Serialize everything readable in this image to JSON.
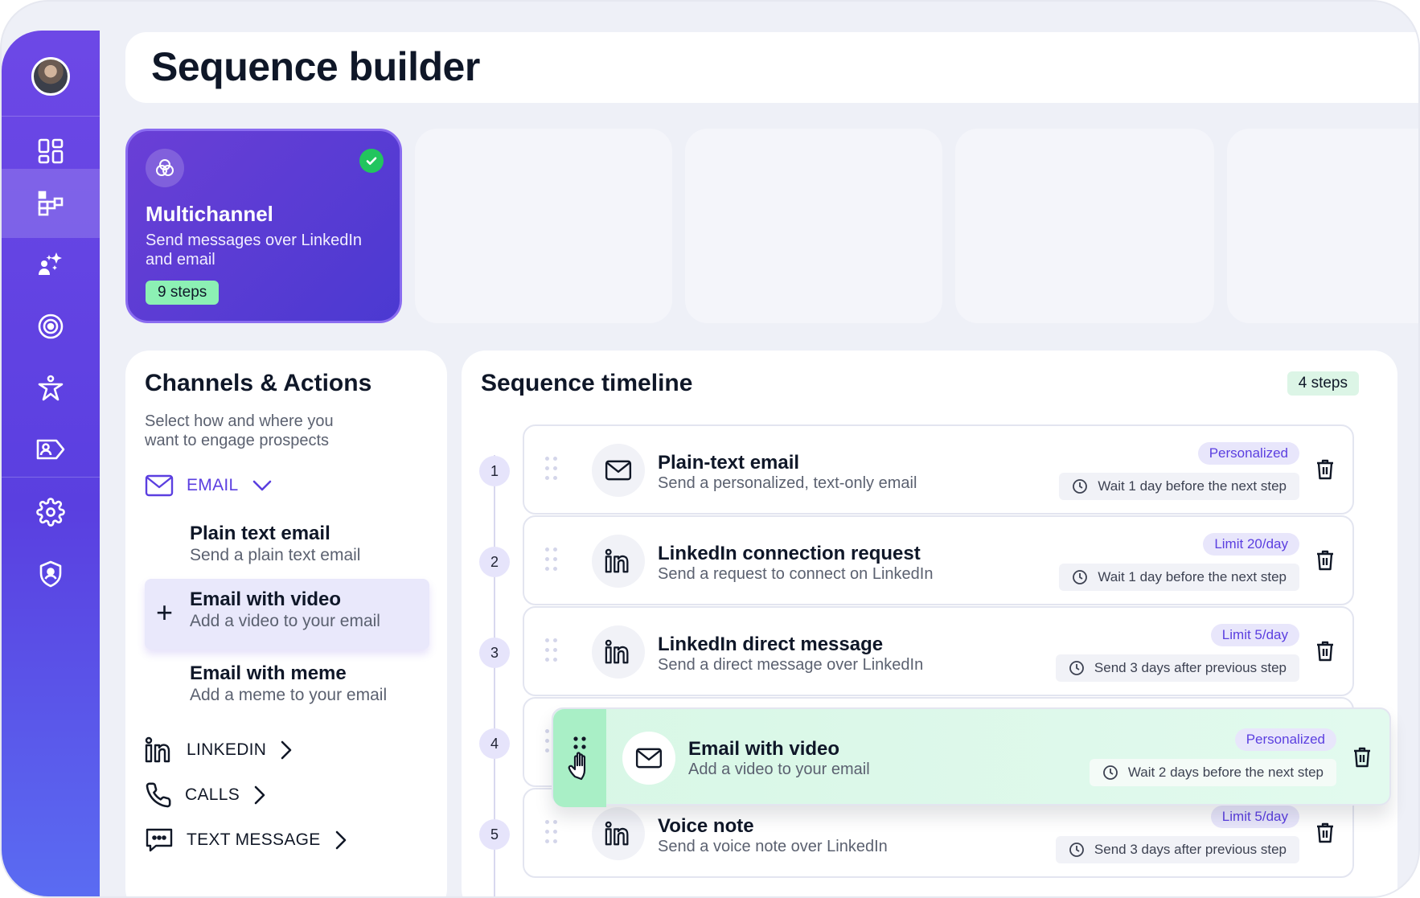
{
  "page": {
    "title": "Sequence builder"
  },
  "sidebar": {
    "items": [
      {
        "icon": "avatar"
      },
      {
        "icon": "dashboard-icon"
      },
      {
        "icon": "sequence-icon",
        "active": true
      },
      {
        "icon": "sparkle-user-icon"
      },
      {
        "icon": "target-icon"
      },
      {
        "icon": "person-star-icon"
      },
      {
        "icon": "contact-tag-icon"
      },
      {
        "icon": "gear-icon"
      },
      {
        "icon": "shield-user-icon"
      }
    ]
  },
  "template_card": {
    "title": "Multichannel",
    "description": "Send messages over LinkedIn and email",
    "steps": "9 steps",
    "selected": true
  },
  "channels": {
    "title": "Channels & Actions",
    "subtitle": "Select how and where you want to engage prospects",
    "email_label": "EMAIL",
    "actions": [
      {
        "title": "Plain text email",
        "subtitle": "Send a plain text email"
      },
      {
        "title": "Email with video",
        "subtitle": "Add a video to your email"
      },
      {
        "title": "Email with meme",
        "subtitle": "Add a meme to your email"
      }
    ],
    "linkedin_label": "LINKEDIN",
    "calls_label": "CALLS",
    "text_message_label": "TEXT MESSAGE"
  },
  "timeline": {
    "title": "Sequence timeline",
    "steps_badge": "4 steps",
    "steps": [
      {
        "number": "1",
        "channel": "email",
        "title": "Plain-text email",
        "subtitle": "Send a personalized, text-only email",
        "badge": "Personalized",
        "wait": "Wait 1 day before the next step"
      },
      {
        "number": "2",
        "channel": "linkedin",
        "title": "LinkedIn connection request",
        "subtitle": "Send a request to connect on LinkedIn",
        "badge": "Limit 20/day",
        "wait": "Wait 1 day before the next step"
      },
      {
        "number": "3",
        "channel": "linkedin",
        "title": "LinkedIn direct message",
        "subtitle": "Send a direct message over LinkedIn",
        "badge": "Limit 5/day",
        "wait": "Send 3 days after previous step"
      },
      {
        "number": "4"
      },
      {
        "number": "5",
        "channel": "linkedin",
        "title": "Voice note",
        "subtitle": "Send a voice note over LinkedIn",
        "badge": "Limit 5/day",
        "wait": "Send 3 days after previous step"
      }
    ],
    "dragging": {
      "channel": "email",
      "title": "Email with video",
      "subtitle": "Add a video to your email",
      "badge": "Personalized",
      "wait": "Wait 2 days before the next step"
    }
  },
  "colors": {
    "accent": "#5b3fe0",
    "success": "#22c55e",
    "drag_bg": "#d8f7e6"
  }
}
